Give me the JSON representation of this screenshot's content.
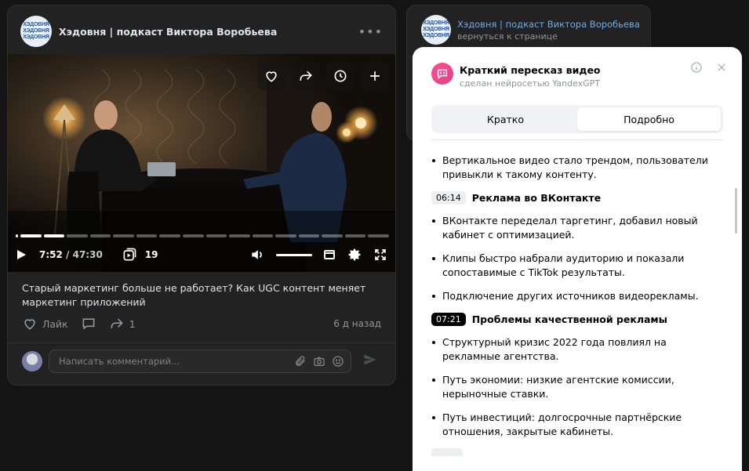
{
  "post": {
    "author": "Хэдовня | подкаст Виктора Воробьева",
    "logo_text": "ХЭДОВНЯ ХЭДОВНЯ ХЭДОВНЯ",
    "more_label": "•••",
    "video": {
      "current_time": "7:52",
      "duration": "/ 47:30",
      "clips_count": "19",
      "progress_segments": 16,
      "progress_completed": 2,
      "volume_level": 1.0
    },
    "caption": "Старый маркетинг больше не работает? Как UGC контент меняет маркетинг приложений",
    "like_label": "Лайк",
    "share_count": "1",
    "date": "6 д назад",
    "comment_placeholder": "Написать комментарий..."
  },
  "mini": {
    "title": "Хэдовня | подкаст Виктора Воробьева",
    "subtitle": "вернуться к странице"
  },
  "summary": {
    "title": "Краткий пересказ видео",
    "subtitle": "сделан нейросетью YandexGPT",
    "tabs": [
      {
        "label": "Кратко",
        "active": false
      },
      {
        "label": "Подробно",
        "active": true
      }
    ],
    "intro_points": [
      "Вертикальное видео стало трендом, пользователи привыкли к такому контенту."
    ],
    "sections": [
      {
        "time": "06:14",
        "title": "Реклама во ВКонтакте",
        "points": [
          "ВКонтакте переделал таргетинг, добавил новый кабинет с оптимизацией.",
          "Клипы быстро набрали аудиторию и показали сопоставимые с TikTok результаты.",
          "Подключение других источников видеорекламы."
        ]
      },
      {
        "time": "07:21",
        "title": "Проблемы качественной рекламы",
        "points": [
          "Структурный кризис 2022 года повлиял на рекламные агентства.",
          "Путь экономии: низкие агентские комиссии, нерыночные ставки.",
          "Путь инвестиций: долгосрочные партнёрские отношения, закрытые кабинеты."
        ]
      }
    ]
  },
  "colors": {
    "page_bg": "#141414",
    "card_bg": "#222222",
    "link": "#71aaeb",
    "gpt_accent": "#ff4f8b"
  }
}
